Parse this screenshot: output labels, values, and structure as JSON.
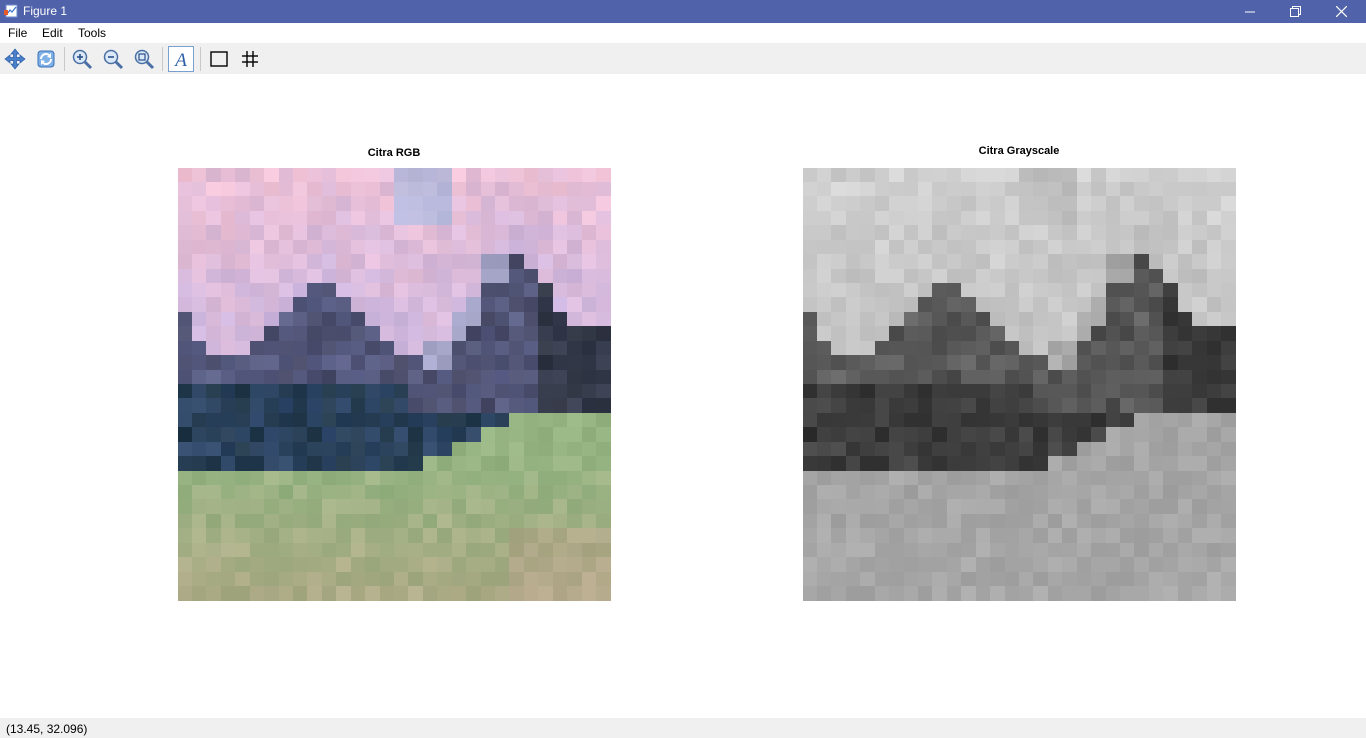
{
  "window": {
    "title": "Figure 1",
    "title_bar_color": "#5063aa"
  },
  "menu": {
    "items": [
      "File",
      "Edit",
      "Tools"
    ]
  },
  "toolbar": {
    "icons": [
      "pan-icon",
      "rotate-icon",
      "zoom-in-icon",
      "zoom-out-icon",
      "zoom-fit-icon",
      "text-insert-icon",
      "box-icon",
      "grid-icon"
    ]
  },
  "axes": [
    {
      "title": "Citra RGB"
    },
    {
      "title": "Citra Grayscale"
    }
  ],
  "status": {
    "coords": "(13.45, 32.096)"
  }
}
